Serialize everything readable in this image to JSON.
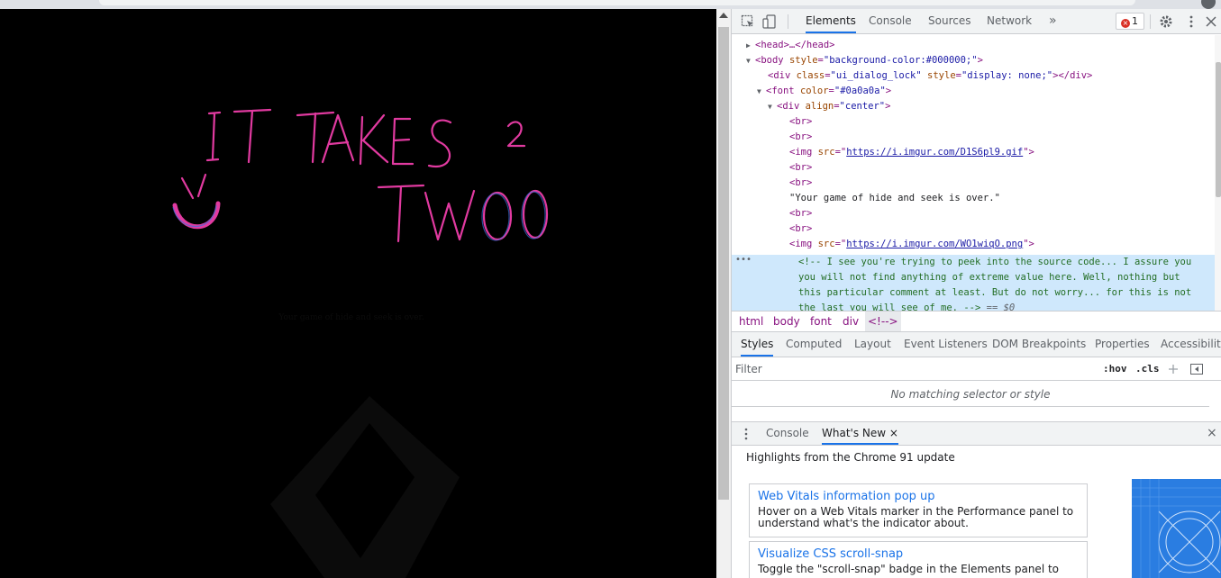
{
  "page": {
    "caption": "Your game of hide and seek is over.",
    "background_color": "#000000",
    "title_color": "#e13aa0"
  },
  "devtools": {
    "tabs": [
      {
        "label": "Elements",
        "active": true
      },
      {
        "label": "Console",
        "active": false
      },
      {
        "label": "Sources",
        "active": false
      },
      {
        "label": "Network",
        "active": false
      }
    ],
    "more_tabs": "»",
    "error_count": "1",
    "dom": {
      "head": "<head>…</head>",
      "body_open": {
        "tag": "<body ",
        "attr": "style",
        "value": "\"background-color:#000000;\"",
        "close": ">"
      },
      "div_lock": {
        "tag": "<div ",
        "attr1": "class",
        "value1": "\"ui_dialog_lock\"",
        "attr2": "style",
        "value2": "\"display: none;\"",
        "close": "></div>"
      },
      "font_open": {
        "tag": "<font ",
        "attr": "color",
        "value": "\"#0a0a0a\"",
        "close": ">"
      },
      "div_center": {
        "tag": "<div ",
        "attr": "align",
        "value": "\"center\"",
        "close": ">"
      },
      "br": "<br>",
      "img1": {
        "tag": "<img ",
        "attr": "src",
        "value": "https://i.imgur.com/D1S6pl9.gif",
        "close": ">"
      },
      "text_node": "\"Your game of hide and seek is over.\"",
      "img2": {
        "tag": "<img ",
        "attr": "src",
        "value": "https://i.imgur.com/WO1wiqO.png",
        "close": ">"
      },
      "comment_lines": [
        "<!-- I see you're trying to peek into the source code... I assure you",
        "you will not find anything of extreme value here. Well, nothing but",
        "this particular comment at least. But do not worry... for this is not",
        "the last you will see of me. -->"
      ],
      "selected_marker": "== $0",
      "ellipsis": "•••"
    },
    "breadcrumbs": [
      "html",
      "body",
      "font",
      "div",
      "<!-->"
    ],
    "styles_tabs": [
      "Styles",
      "Computed",
      "Layout",
      "Event Listeners",
      "DOM Breakpoints",
      "Properties",
      "Accessibility"
    ],
    "filter_placeholder": "Filter",
    "hov_label": ":hov",
    "cls_label": ".cls",
    "no_match": "No matching selector or style",
    "drawer": {
      "tabs": [
        "Console",
        "What's New"
      ],
      "close_x": "×",
      "header": "Highlights from the Chrome 91 update",
      "cards": [
        {
          "title": "Web Vitals information pop up",
          "desc": "Hover on a Web Vitals marker in the Performance panel to understand what's the indicator about."
        },
        {
          "title": "Visualize CSS scroll-snap",
          "desc": "Toggle the \"scroll-snap\" badge in the Elements panel to"
        }
      ]
    },
    "colors": {
      "accent": "#1a73e8",
      "selection": "#cfe8fc",
      "tag": "#881280",
      "attr": "#994500",
      "value": "#1a1aa6",
      "comment": "#236e25"
    }
  }
}
